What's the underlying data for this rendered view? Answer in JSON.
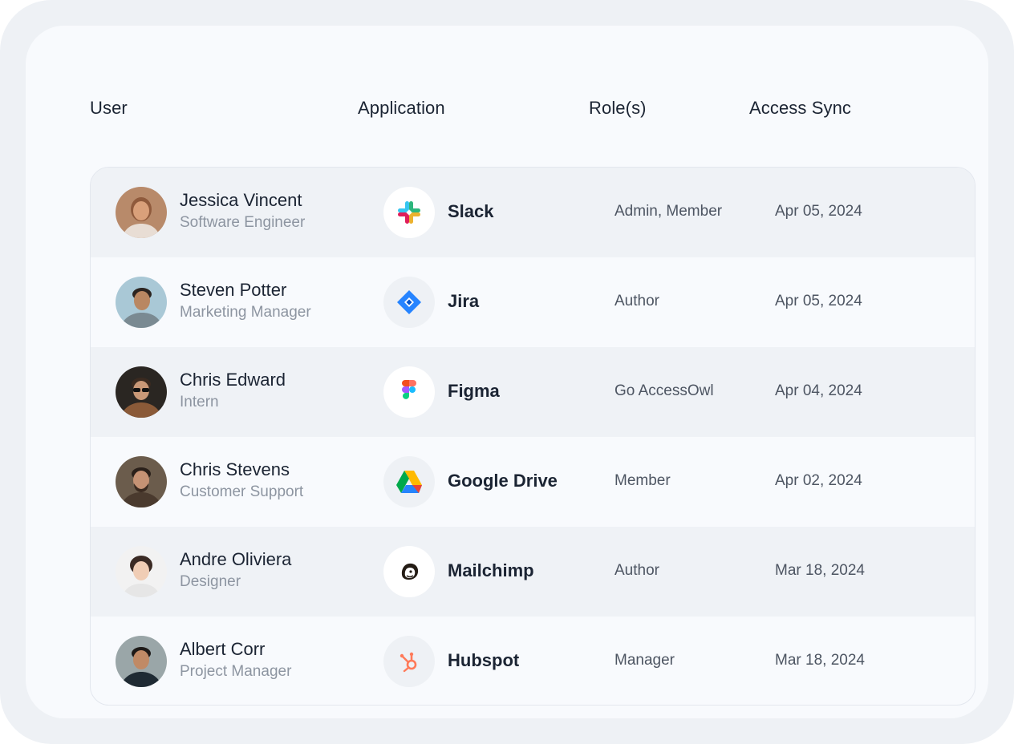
{
  "table": {
    "headers": [
      "User",
      "Application",
      "Role(s)",
      "Access Sync"
    ],
    "rows": [
      {
        "user": "Jessica Vincent",
        "title": "Software Engineer",
        "app": "Slack",
        "app_icon": "slack-icon",
        "roles": "Admin, Member",
        "sync": "Apr 05, 2024"
      },
      {
        "user": "Steven Potter",
        "title": "Marketing Manager",
        "app": "Jira",
        "app_icon": "jira-icon",
        "roles": "Author",
        "sync": "Apr 05, 2024"
      },
      {
        "user": "Chris Edward",
        "title": "Intern",
        "app": "Figma",
        "app_icon": "figma-icon",
        "roles": "Go AccessOwl",
        "sync": "Apr 04, 2024"
      },
      {
        "user": "Chris Stevens",
        "title": "Customer Support",
        "app": "Google Drive",
        "app_icon": "google-drive-icon",
        "roles": "Member",
        "sync": "Apr 02, 2024"
      },
      {
        "user": "Andre Oliviera",
        "title": "Designer",
        "app": "Mailchimp",
        "app_icon": "mailchimp-icon",
        "roles": "Author",
        "sync": "Mar 18, 2024"
      },
      {
        "user": "Albert Corr",
        "title": "Project Manager",
        "app": "Hubspot",
        "app_icon": "hubspot-icon",
        "roles": "Manager",
        "sync": "Mar 18, 2024"
      }
    ]
  },
  "colors": {
    "outer_frame": "#eef1f5",
    "card": "#f8fafd",
    "alt_row": "#eff2f6",
    "text_primary": "#1b2433",
    "text_secondary": "#8d95a1",
    "text_muted": "#4d5562"
  }
}
